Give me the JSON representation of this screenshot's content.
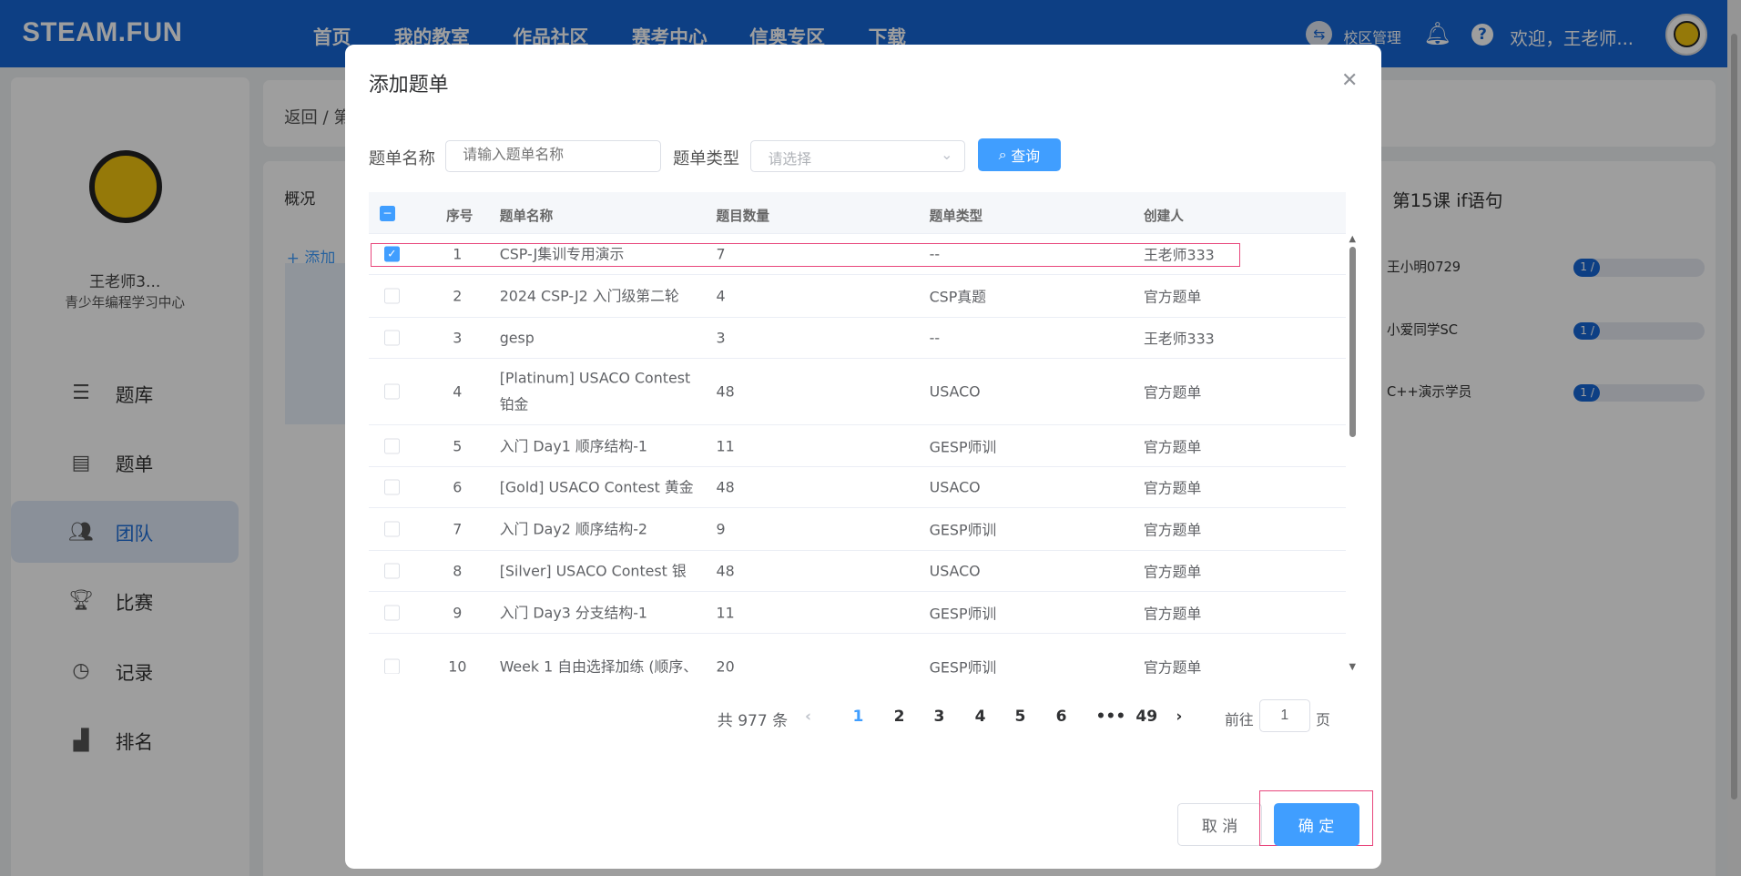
{
  "header": {
    "logo": "STEAM.FUN",
    "nav": [
      "首页",
      "我的教室",
      "作品社区",
      "赛考中心",
      "信奥专区",
      "下载"
    ],
    "campus": "校区管理",
    "welcome": "欢迎，王老师..."
  },
  "sidebar": {
    "user_name": "王老师3...",
    "org": "青少年编程学习中心",
    "items": [
      {
        "label": "题库",
        "icon": "list-edit-icon"
      },
      {
        "label": "题单",
        "icon": "clipboard-icon"
      },
      {
        "label": "团队",
        "icon": "users-icon",
        "active": true
      },
      {
        "label": "比赛",
        "icon": "trophy-icon"
      },
      {
        "label": "记录",
        "icon": "clock-icon"
      },
      {
        "label": "排名",
        "icon": "bar-chart-icon"
      }
    ]
  },
  "background": {
    "breadcrumb": "返回 / 第",
    "overview_tab": "概况",
    "add_label": "+ 添加",
    "lesson_title": "第15课 if语句",
    "students": [
      {
        "name": "王小明0729",
        "progress": "1 /"
      },
      {
        "name": "小爱同学SC",
        "progress": "1 /"
      },
      {
        "name": "C++演示学员",
        "progress": "1 /"
      }
    ]
  },
  "modal": {
    "title": "添加题单",
    "filters": {
      "name_label": "题单名称",
      "name_placeholder": "请输入题单名称",
      "type_label": "题单类型",
      "type_placeholder": "请选择",
      "search_label": "查询"
    },
    "columns": [
      "序号",
      "题单名称",
      "题目数量",
      "题单类型",
      "创建人"
    ],
    "rows": [
      {
        "no": "1",
        "name": "CSP-J集训专用演示",
        "count": "7",
        "type": "--",
        "creator": "王老师333",
        "checked": true
      },
      {
        "no": "2",
        "name": "2024 CSP-J2 入门级第二轮",
        "count": "4",
        "type": "CSP真题",
        "creator": "官方题单"
      },
      {
        "no": "3",
        "name": "gesp",
        "count": "3",
        "type": "--",
        "creator": "王老师333"
      },
      {
        "no": "4",
        "name": "[Platinum] USACO Contest 铂金",
        "count": "48",
        "type": "USACO",
        "creator": "官方题单"
      },
      {
        "no": "5",
        "name": "入门 Day1 顺序结构-1",
        "count": "11",
        "type": "GESP师训",
        "creator": "官方题单"
      },
      {
        "no": "6",
        "name": "[Gold] USACO Contest 黄金",
        "count": "48",
        "type": "USACO",
        "creator": "官方题单"
      },
      {
        "no": "7",
        "name": "入门 Day2 顺序结构-2",
        "count": "9",
        "type": "GESP师训",
        "creator": "官方题单"
      },
      {
        "no": "8",
        "name": "[Silver] USACO Contest 银",
        "count": "48",
        "type": "USACO",
        "creator": "官方题单"
      },
      {
        "no": "9",
        "name": "入门 Day3 分支结构-1",
        "count": "11",
        "type": "GESP师训",
        "creator": "官方题单"
      },
      {
        "no": "10",
        "name": "Week 1 自由选择加练 (顺序、",
        "count": "20",
        "type": "GESP师训",
        "creator": "官方题单"
      }
    ],
    "pagination": {
      "total": "共 977 条",
      "pages": [
        "1",
        "2",
        "3",
        "4",
        "5",
        "6",
        "•••",
        "49"
      ],
      "current": "1",
      "goto_label": "前往",
      "goto_value": "1",
      "page_suffix": "页"
    },
    "cancel": "取 消",
    "confirm": "确 定"
  },
  "colors": {
    "primary": "#409eff",
    "header": "#1566d6",
    "highlight": "#e8467c"
  }
}
